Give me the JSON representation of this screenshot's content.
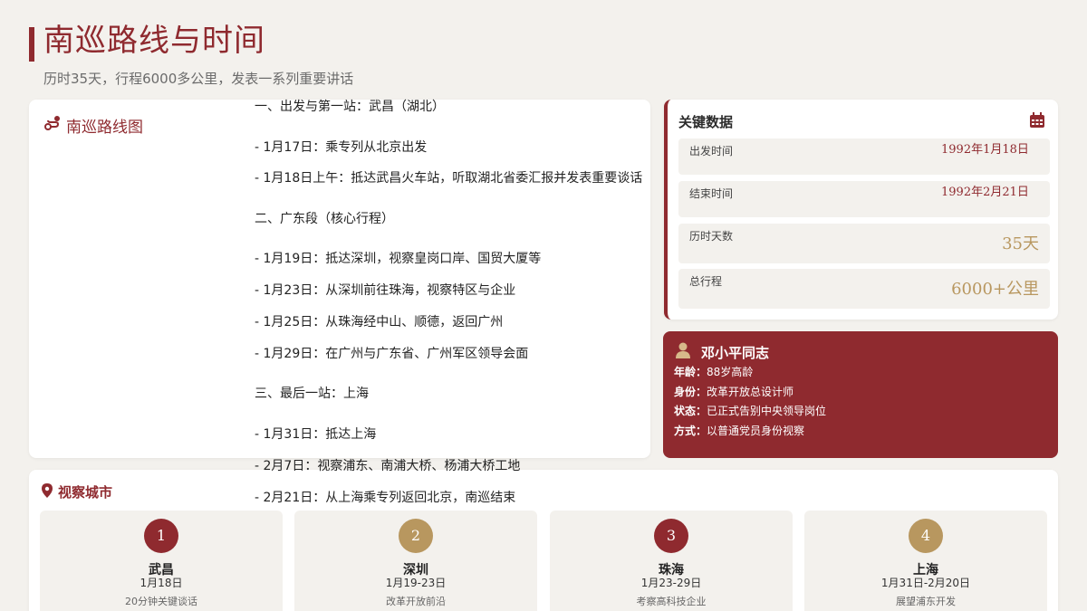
{
  "header": {
    "title": "南巡路线与时间",
    "subtitle": "历时35天，行程6000多公里，发表一系列重要讲话"
  },
  "route": {
    "heading": "南巡路线图",
    "lines": [
      "一、出发与第一站：武昌（湖北）",
      "- 1月17日：乘专列从北京出发",
      "- 1月18日上午：抵达武昌火车站，听取湖北省委汇报并发表重要谈话",
      "二、广东段（核心行程）",
      "- 1月19日：抵达深圳，视察皇岗口岸、国贸大厦等",
      "- 1月23日：从深圳前往珠海，视察特区与企业",
      "- 1月25日：从珠海经中山、顺德，返回广州",
      "- 1月29日：在广州与广东省、广州军区领导会面",
      "三、最后一站：上海",
      "- 1月31日：抵达上海",
      "- 2月7日：视察浦东、南浦大桥、杨浦大桥工地",
      "- 2月21日：从上海乘专列返回北京，南巡结束"
    ]
  },
  "stats": {
    "heading": "关键数据",
    "start_label": "出发时间",
    "start_value": "1992年1月18日",
    "end_label": "结束时间",
    "end_value": "1992年2月21日",
    "days_label": "历时天数",
    "days_value": "35天",
    "distance_label": "总行程",
    "distance_value": "6000+公里"
  },
  "person": {
    "name": "邓小平同志",
    "age_label": "年龄：",
    "age_value": "88岁高龄",
    "identity_label": "身份：",
    "identity_value": "改革开放总设计师",
    "status_label": "状态：",
    "status_value": "已正式告别中央领导岗位",
    "mode_label": "方式：",
    "mode_value": "以普通党员身份视察"
  },
  "cities": {
    "heading": "视察城市",
    "items": [
      {
        "num": "1",
        "name": "武昌",
        "date": "1月18日",
        "desc": "20分钟关键谈话",
        "color": "#8f2a2f"
      },
      {
        "num": "2",
        "name": "深圳",
        "date": "1月19-23日",
        "desc": "改革开放前沿",
        "color": "#b8975f"
      },
      {
        "num": "3",
        "name": "珠海",
        "date": "1月23-29日",
        "desc": "考察高科技企业",
        "color": "#8f2a2f"
      },
      {
        "num": "4",
        "name": "上海",
        "date": "1月31日-2月20日",
        "desc": "展望浦东开发",
        "color": "#b8975f"
      }
    ]
  },
  "colors": {
    "accent": "#8f2a2f",
    "gold": "#b8975f",
    "background": "#f3f1ed"
  }
}
